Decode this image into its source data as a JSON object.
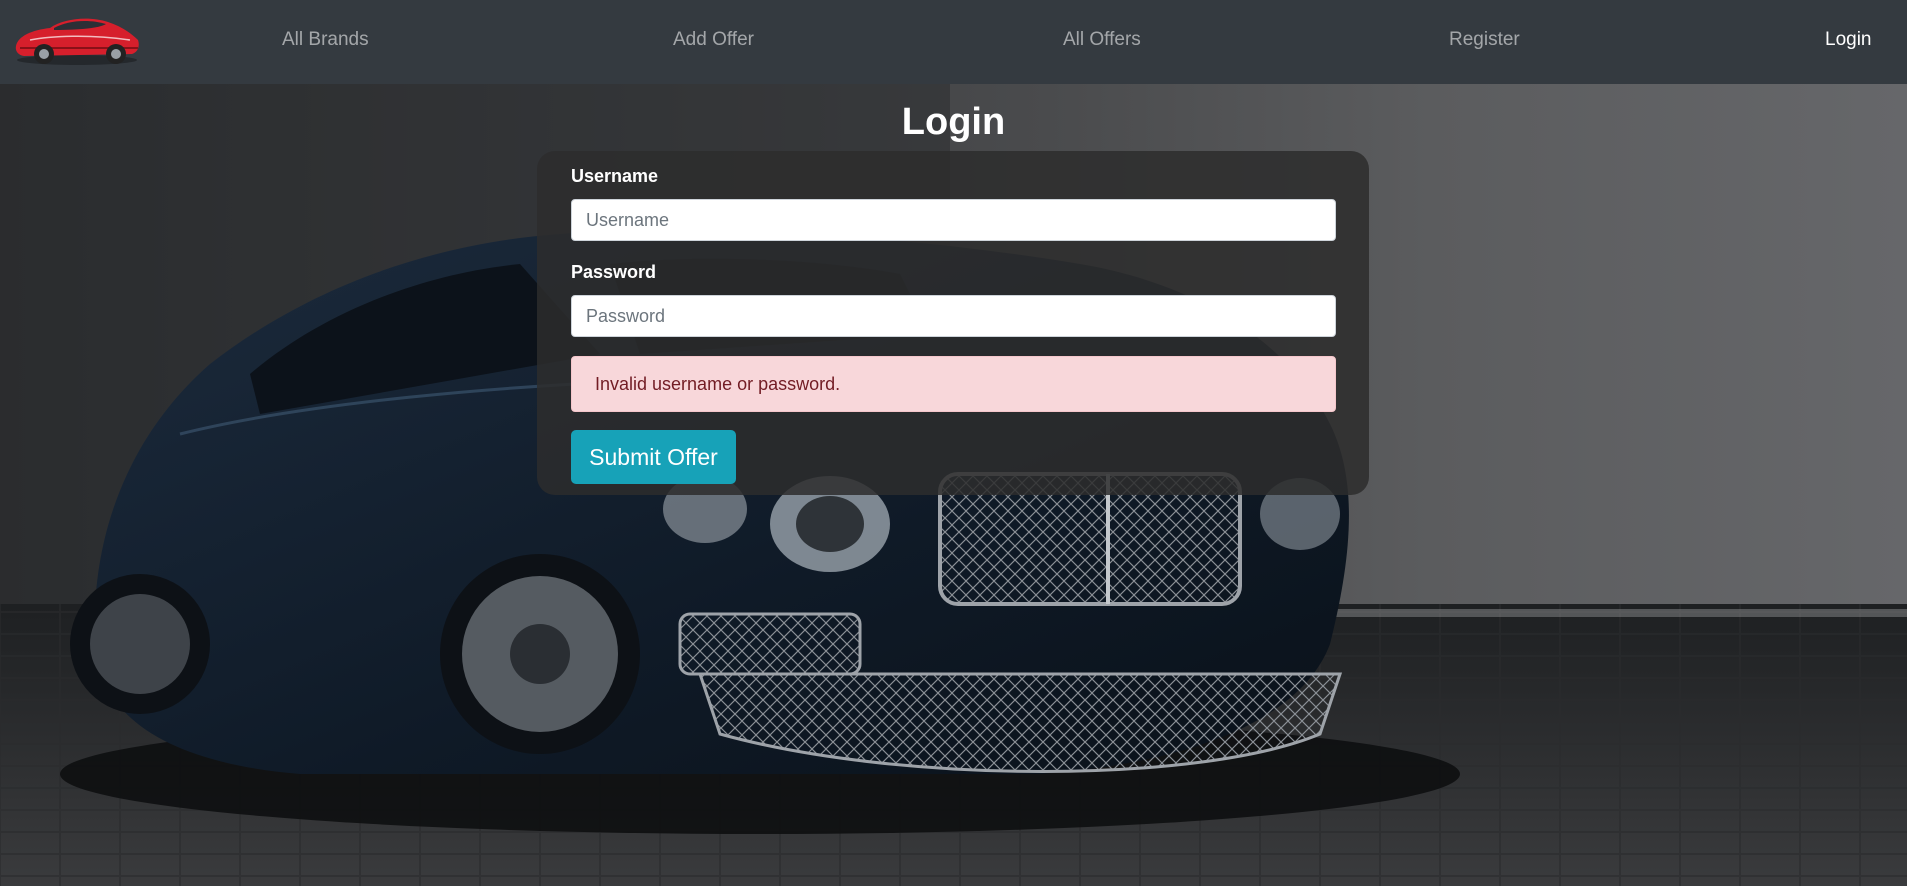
{
  "nav": {
    "logo_icon": "red-sports-car-logo",
    "links": [
      {
        "label": "All Brands"
      },
      {
        "label": "Add Offer"
      },
      {
        "label": "All Offers"
      },
      {
        "label": "Register"
      },
      {
        "label": "Login",
        "active": true
      }
    ]
  },
  "background": {
    "icon": "dark-blue-luxury-car-photo"
  },
  "form": {
    "title": "Login",
    "username": {
      "label": "Username",
      "placeholder": "Username",
      "value": ""
    },
    "password": {
      "label": "Password",
      "placeholder": "Password",
      "value": ""
    },
    "error_message": "Invalid username or password.",
    "submit_label": "Submit Offer"
  },
  "colors": {
    "navbar": "#343a40",
    "submit": "#17a2b8",
    "alert_bg": "#f8d7da",
    "alert_text": "#721c24"
  }
}
